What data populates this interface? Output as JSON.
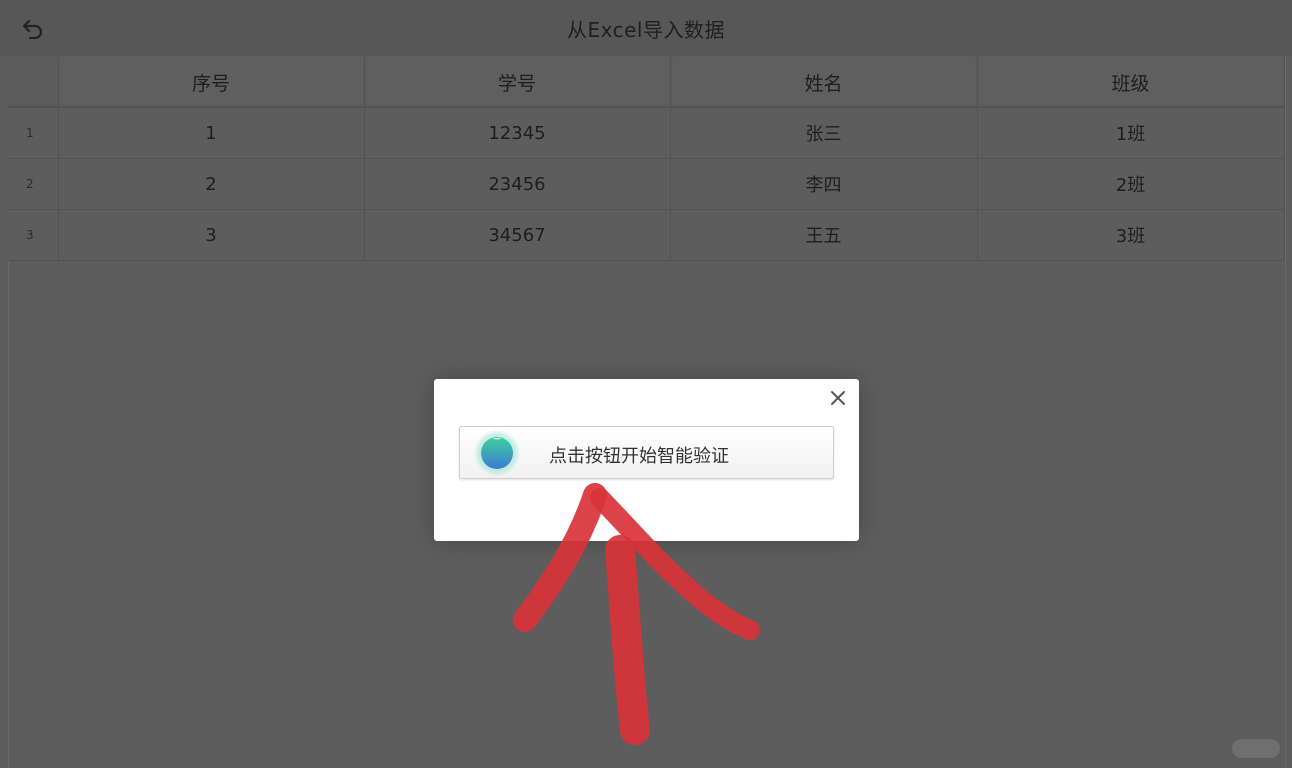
{
  "header": {
    "title": "从Excel导入数据",
    "back_icon": "undo-arrow-icon"
  },
  "table": {
    "columns": [
      "序号",
      "学号",
      "姓名",
      "班级"
    ],
    "rows": [
      {
        "index": "1",
        "cells": [
          "1",
          "12345",
          "张三",
          "1班"
        ]
      },
      {
        "index": "2",
        "cells": [
          "2",
          "23456",
          "李四",
          "2班"
        ]
      },
      {
        "index": "3",
        "cells": [
          "3",
          "34567",
          "王五",
          "3班"
        ]
      }
    ]
  },
  "dialog": {
    "close_icon": "close-icon",
    "verify_label": "点击按钮开始智能验证",
    "logo_icon": "smart-captcha-logo-icon"
  },
  "overlay": {
    "annotation": "red-arrow-pointing-up",
    "annotation_color": "#d9333a"
  },
  "colors": {
    "backdrop": "#5d5d5d",
    "dialog_bg": "#ffffff",
    "logo_top": "#3fd19a",
    "logo_bottom": "#3a7bd5"
  }
}
